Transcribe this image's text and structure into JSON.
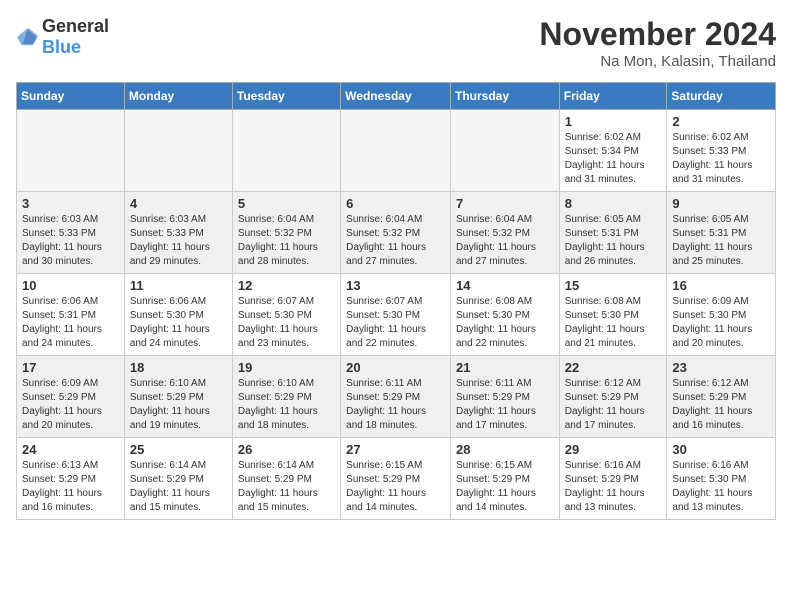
{
  "logo": {
    "general": "General",
    "blue": "Blue"
  },
  "title": "November 2024",
  "location": "Na Mon, Kalasin, Thailand",
  "headers": [
    "Sunday",
    "Monday",
    "Tuesday",
    "Wednesday",
    "Thursday",
    "Friday",
    "Saturday"
  ],
  "weeks": [
    [
      {
        "day": "",
        "info": ""
      },
      {
        "day": "",
        "info": ""
      },
      {
        "day": "",
        "info": ""
      },
      {
        "day": "",
        "info": ""
      },
      {
        "day": "",
        "info": ""
      },
      {
        "day": "1",
        "info": "Sunrise: 6:02 AM\nSunset: 5:34 PM\nDaylight: 11 hours\nand 31 minutes."
      },
      {
        "day": "2",
        "info": "Sunrise: 6:02 AM\nSunset: 5:33 PM\nDaylight: 11 hours\nand 31 minutes."
      }
    ],
    [
      {
        "day": "3",
        "info": "Sunrise: 6:03 AM\nSunset: 5:33 PM\nDaylight: 11 hours\nand 30 minutes."
      },
      {
        "day": "4",
        "info": "Sunrise: 6:03 AM\nSunset: 5:33 PM\nDaylight: 11 hours\nand 29 minutes."
      },
      {
        "day": "5",
        "info": "Sunrise: 6:04 AM\nSunset: 5:32 PM\nDaylight: 11 hours\nand 28 minutes."
      },
      {
        "day": "6",
        "info": "Sunrise: 6:04 AM\nSunset: 5:32 PM\nDaylight: 11 hours\nand 27 minutes."
      },
      {
        "day": "7",
        "info": "Sunrise: 6:04 AM\nSunset: 5:32 PM\nDaylight: 11 hours\nand 27 minutes."
      },
      {
        "day": "8",
        "info": "Sunrise: 6:05 AM\nSunset: 5:31 PM\nDaylight: 11 hours\nand 26 minutes."
      },
      {
        "day": "9",
        "info": "Sunrise: 6:05 AM\nSunset: 5:31 PM\nDaylight: 11 hours\nand 25 minutes."
      }
    ],
    [
      {
        "day": "10",
        "info": "Sunrise: 6:06 AM\nSunset: 5:31 PM\nDaylight: 11 hours\nand 24 minutes."
      },
      {
        "day": "11",
        "info": "Sunrise: 6:06 AM\nSunset: 5:30 PM\nDaylight: 11 hours\nand 24 minutes."
      },
      {
        "day": "12",
        "info": "Sunrise: 6:07 AM\nSunset: 5:30 PM\nDaylight: 11 hours\nand 23 minutes."
      },
      {
        "day": "13",
        "info": "Sunrise: 6:07 AM\nSunset: 5:30 PM\nDaylight: 11 hours\nand 22 minutes."
      },
      {
        "day": "14",
        "info": "Sunrise: 6:08 AM\nSunset: 5:30 PM\nDaylight: 11 hours\nand 22 minutes."
      },
      {
        "day": "15",
        "info": "Sunrise: 6:08 AM\nSunset: 5:30 PM\nDaylight: 11 hours\nand 21 minutes."
      },
      {
        "day": "16",
        "info": "Sunrise: 6:09 AM\nSunset: 5:30 PM\nDaylight: 11 hours\nand 20 minutes."
      }
    ],
    [
      {
        "day": "17",
        "info": "Sunrise: 6:09 AM\nSunset: 5:29 PM\nDaylight: 11 hours\nand 20 minutes."
      },
      {
        "day": "18",
        "info": "Sunrise: 6:10 AM\nSunset: 5:29 PM\nDaylight: 11 hours\nand 19 minutes."
      },
      {
        "day": "19",
        "info": "Sunrise: 6:10 AM\nSunset: 5:29 PM\nDaylight: 11 hours\nand 18 minutes."
      },
      {
        "day": "20",
        "info": "Sunrise: 6:11 AM\nSunset: 5:29 PM\nDaylight: 11 hours\nand 18 minutes."
      },
      {
        "day": "21",
        "info": "Sunrise: 6:11 AM\nSunset: 5:29 PM\nDaylight: 11 hours\nand 17 minutes."
      },
      {
        "day": "22",
        "info": "Sunrise: 6:12 AM\nSunset: 5:29 PM\nDaylight: 11 hours\nand 17 minutes."
      },
      {
        "day": "23",
        "info": "Sunrise: 6:12 AM\nSunset: 5:29 PM\nDaylight: 11 hours\nand 16 minutes."
      }
    ],
    [
      {
        "day": "24",
        "info": "Sunrise: 6:13 AM\nSunset: 5:29 PM\nDaylight: 11 hours\nand 16 minutes."
      },
      {
        "day": "25",
        "info": "Sunrise: 6:14 AM\nSunset: 5:29 PM\nDaylight: 11 hours\nand 15 minutes."
      },
      {
        "day": "26",
        "info": "Sunrise: 6:14 AM\nSunset: 5:29 PM\nDaylight: 11 hours\nand 15 minutes."
      },
      {
        "day": "27",
        "info": "Sunrise: 6:15 AM\nSunset: 5:29 PM\nDaylight: 11 hours\nand 14 minutes."
      },
      {
        "day": "28",
        "info": "Sunrise: 6:15 AM\nSunset: 5:29 PM\nDaylight: 11 hours\nand 14 minutes."
      },
      {
        "day": "29",
        "info": "Sunrise: 6:16 AM\nSunset: 5:29 PM\nDaylight: 11 hours\nand 13 minutes."
      },
      {
        "day": "30",
        "info": "Sunrise: 6:16 AM\nSunset: 5:30 PM\nDaylight: 11 hours\nand 13 minutes."
      }
    ]
  ]
}
